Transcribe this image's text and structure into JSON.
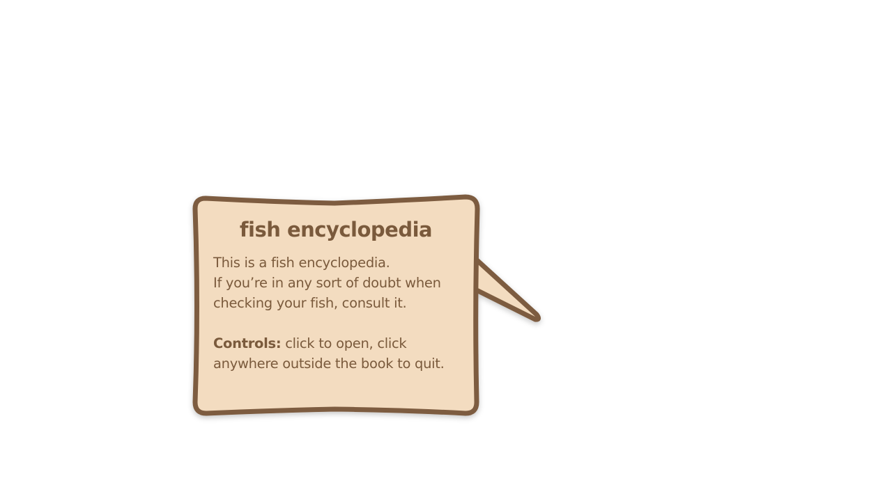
{
  "tooltip": {
    "title": "fish encyclopedia",
    "line1": "This is a fish encyclopedia.",
    "line2": "If you’re in any sort of doubt when checking your fish, consult it.",
    "controls_label": "Controls:",
    "controls_text": " click to open, click anywhere outside the book to quit."
  },
  "colors": {
    "paper": "#f3dcc0",
    "border": "#7d5c3f",
    "text": "#7a5a3c",
    "background": "#ffffff"
  }
}
